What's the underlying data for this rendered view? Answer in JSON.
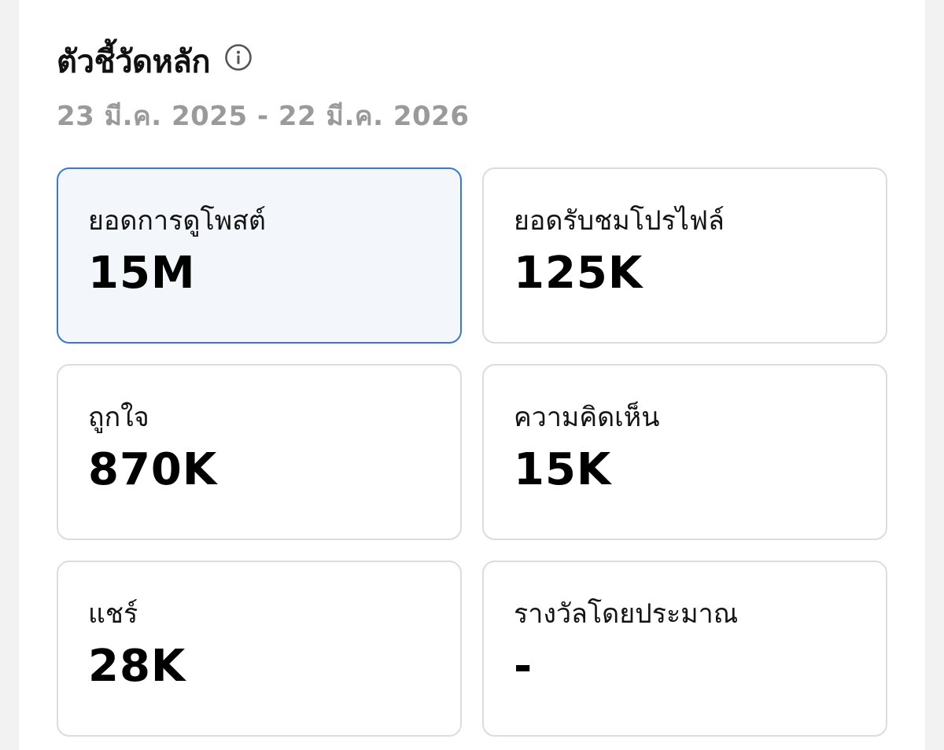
{
  "header": {
    "title": "ตัวชี้วัดหลัก",
    "info_icon": "info-icon",
    "date_range": "23 มี.ค. 2025 - 22 มี.ค. 2026"
  },
  "metrics": [
    {
      "label": "ยอดการดูโพสต์",
      "value": "15M",
      "selected": true
    },
    {
      "label": "ยอดรับชมโปรไฟล์",
      "value": "125K",
      "selected": false
    },
    {
      "label": "ถูกใจ",
      "value": "870K",
      "selected": false
    },
    {
      "label": "ความคิดเห็น",
      "value": "15K",
      "selected": false
    },
    {
      "label": "แชร์",
      "value": "28K",
      "selected": false
    },
    {
      "label": "รางวัลโดยประมาณ",
      "value": "-",
      "selected": false
    }
  ],
  "colors": {
    "selected_border": "#3a78d0",
    "selected_background": "#f3f7fc",
    "date_text": "#9a9a9a"
  }
}
